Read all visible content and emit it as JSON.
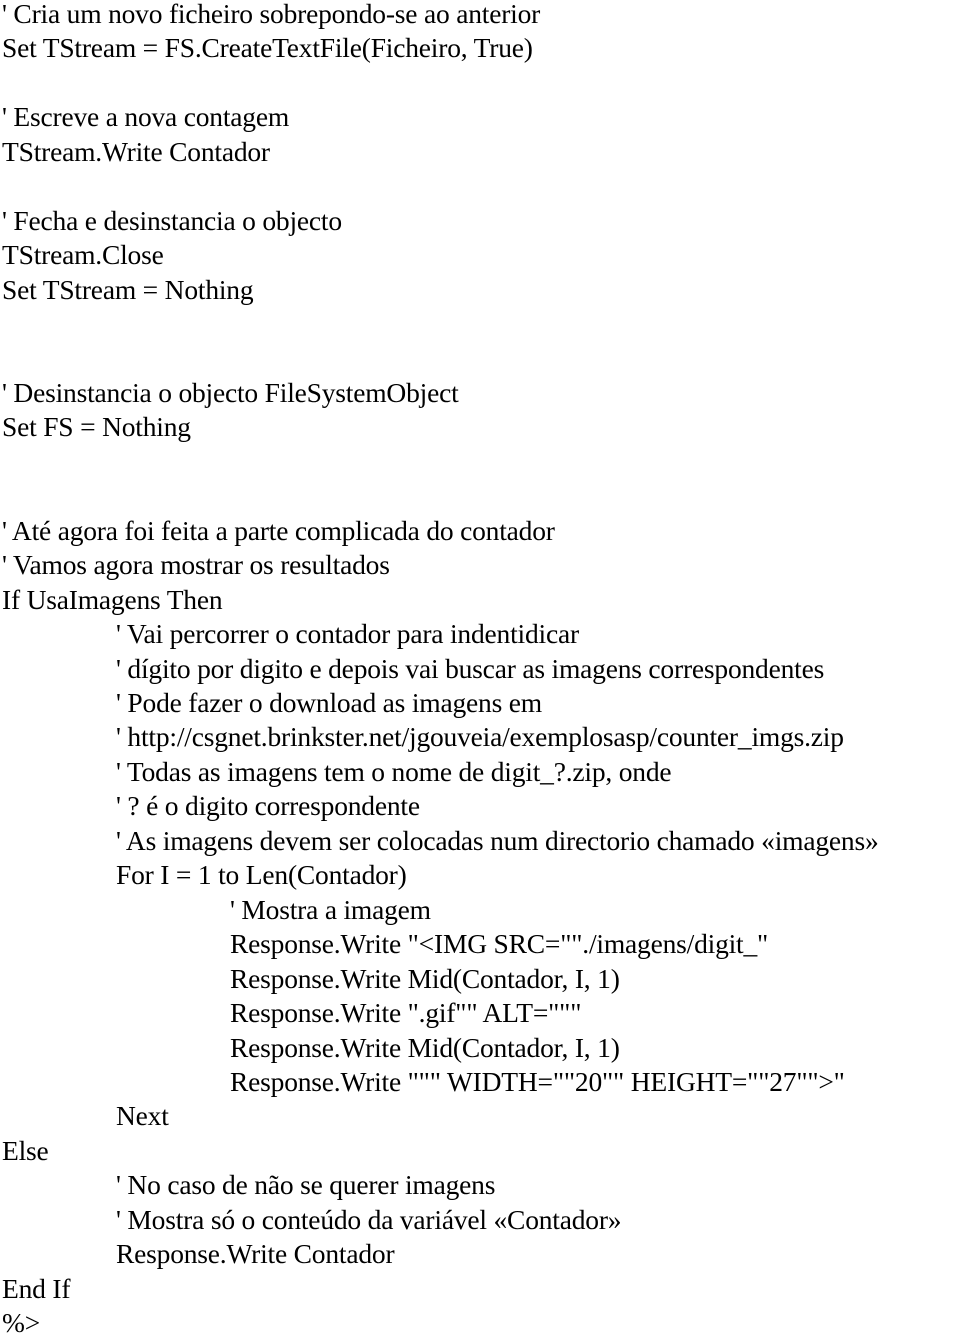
{
  "document": {
    "type": "asp-vbscript-code-listing",
    "lines": [
      {
        "text": "' Cria um novo ficheiro sobrepondo-se ao anterior",
        "indent": 0,
        "row": 0
      },
      {
        "text": "Set TStream = FS.CreateTextFile(Ficheiro, True)",
        "indent": 0,
        "row": 1
      },
      {
        "text": "' Escreve a nova contagem",
        "indent": 0,
        "row": 3
      },
      {
        "text": "TStream.Write Contador",
        "indent": 0,
        "row": 4
      },
      {
        "text": "' Fecha e desinstancia o objecto",
        "indent": 0,
        "row": 6
      },
      {
        "text": "TStream.Close",
        "indent": 0,
        "row": 7
      },
      {
        "text": "Set TStream = Nothing",
        "indent": 0,
        "row": 8
      },
      {
        "text": "' Desinstancia o objecto FileSystemObject",
        "indent": 0,
        "row": 11
      },
      {
        "text": "Set FS = Nothing",
        "indent": 0,
        "row": 12
      },
      {
        "text": "' Até agora foi feita a parte complicada do contador",
        "indent": 0,
        "row": 15
      },
      {
        "text": "' Vamos agora mostrar os resultados",
        "indent": 0,
        "row": 16
      },
      {
        "text": "If UsaImagens Then",
        "indent": 0,
        "row": 17
      },
      {
        "text": "' Vai percorrer o contador para indentidicar",
        "indent": 1,
        "row": 18
      },
      {
        "text": "' dígito por digito e depois vai buscar as imagens correspondentes",
        "indent": 1,
        "row": 19
      },
      {
        "text": "' Pode fazer o download as imagens em",
        "indent": 1,
        "row": 20
      },
      {
        "text": "' http://csgnet.brinkster.net/jgouveia/exemplosasp/counter_imgs.zip",
        "indent": 1,
        "row": 21
      },
      {
        "text": "' Todas as imagens tem o nome de digit_?.zip, onde",
        "indent": 1,
        "row": 22
      },
      {
        "text": "' ? é o digito correspondente",
        "indent": 1,
        "row": 23
      },
      {
        "text": "' As imagens devem ser colocadas num directorio chamado «imagens»",
        "indent": 1,
        "row": 24
      },
      {
        "text": "For I = 1 to Len(Contador)",
        "indent": 1,
        "row": 25
      },
      {
        "text": "' Mostra a imagem",
        "indent": 2,
        "row": 26
      },
      {
        "text": "Response.Write \"<IMG SRC=\"\"./imagens/digit_\"",
        "indent": 2,
        "row": 27
      },
      {
        "text": "Response.Write Mid(Contador, I, 1)",
        "indent": 2,
        "row": 28
      },
      {
        "text": "Response.Write \".gif\"\" ALT=\"\"\"",
        "indent": 2,
        "row": 29
      },
      {
        "text": "Response.Write Mid(Contador, I, 1)",
        "indent": 2,
        "row": 30
      },
      {
        "text": "Response.Write \"\"\" WIDTH=\"\"20\"\" HEIGHT=\"\"27\"\">\"",
        "indent": 2,
        "row": 31
      },
      {
        "text": "Next",
        "indent": 1,
        "row": 32
      },
      {
        "text": "Else",
        "indent": 0,
        "row": 33
      },
      {
        "text": "' No caso de não se querer imagens",
        "indent": 1,
        "row": 34
      },
      {
        "text": "' Mostra só o conteúdo da variável «Contador»",
        "indent": 1,
        "row": 35
      },
      {
        "text": "Response.Write Contador",
        "indent": 1,
        "row": 36
      },
      {
        "text": "End If",
        "indent": 0,
        "row": 37
      },
      {
        "text": "%>",
        "indent": 0,
        "row": 38
      }
    ]
  }
}
